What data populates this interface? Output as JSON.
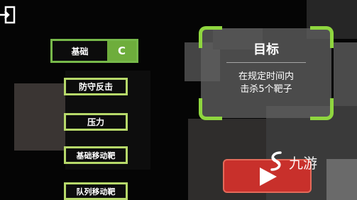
{
  "modes": {
    "basic": {
      "label": "基础",
      "grade": "C"
    },
    "counter": {
      "label": "防守反击"
    },
    "pressure": {
      "label": "压力"
    },
    "moving_target": {
      "label": "基础移动靶"
    },
    "queue_target": {
      "label": "队列移动靶"
    }
  },
  "goal": {
    "title": "目标",
    "line1": "在规定时间内",
    "line2": "击杀5个靶子"
  },
  "watermark": {
    "text": "九游"
  },
  "colors": {
    "accent_green": "#8fd63f",
    "play_red": "#c8302b"
  },
  "icons": {
    "exit": "exit-icon",
    "play": "play-icon",
    "watermark_logo": "jiuyou-logo-icon"
  }
}
